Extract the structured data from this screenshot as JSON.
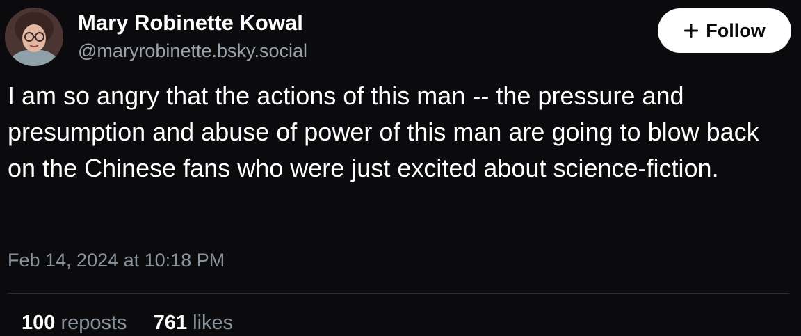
{
  "author": {
    "display_name": "Mary Robinette Kowal",
    "handle": "@maryrobinette.bsky.social"
  },
  "follow_button": {
    "label": "Follow",
    "icon": "plus-icon"
  },
  "post": {
    "text": "I am so angry that the actions of this man -- the pressure and presumption and abuse of power of this man are going to blow back on the Chinese fans who were just excited about science-fiction.",
    "timestamp": "Feb 14, 2024 at 10:18 PM"
  },
  "stats": {
    "reposts_count": "100",
    "reposts_label": "reposts",
    "likes_count": "761",
    "likes_label": "likes"
  },
  "colors": {
    "background": "#0b0b0e",
    "text": "#ffffff",
    "muted_text": "#8a929c",
    "button_bg": "#ffffff",
    "divider": "#2b2f35"
  }
}
